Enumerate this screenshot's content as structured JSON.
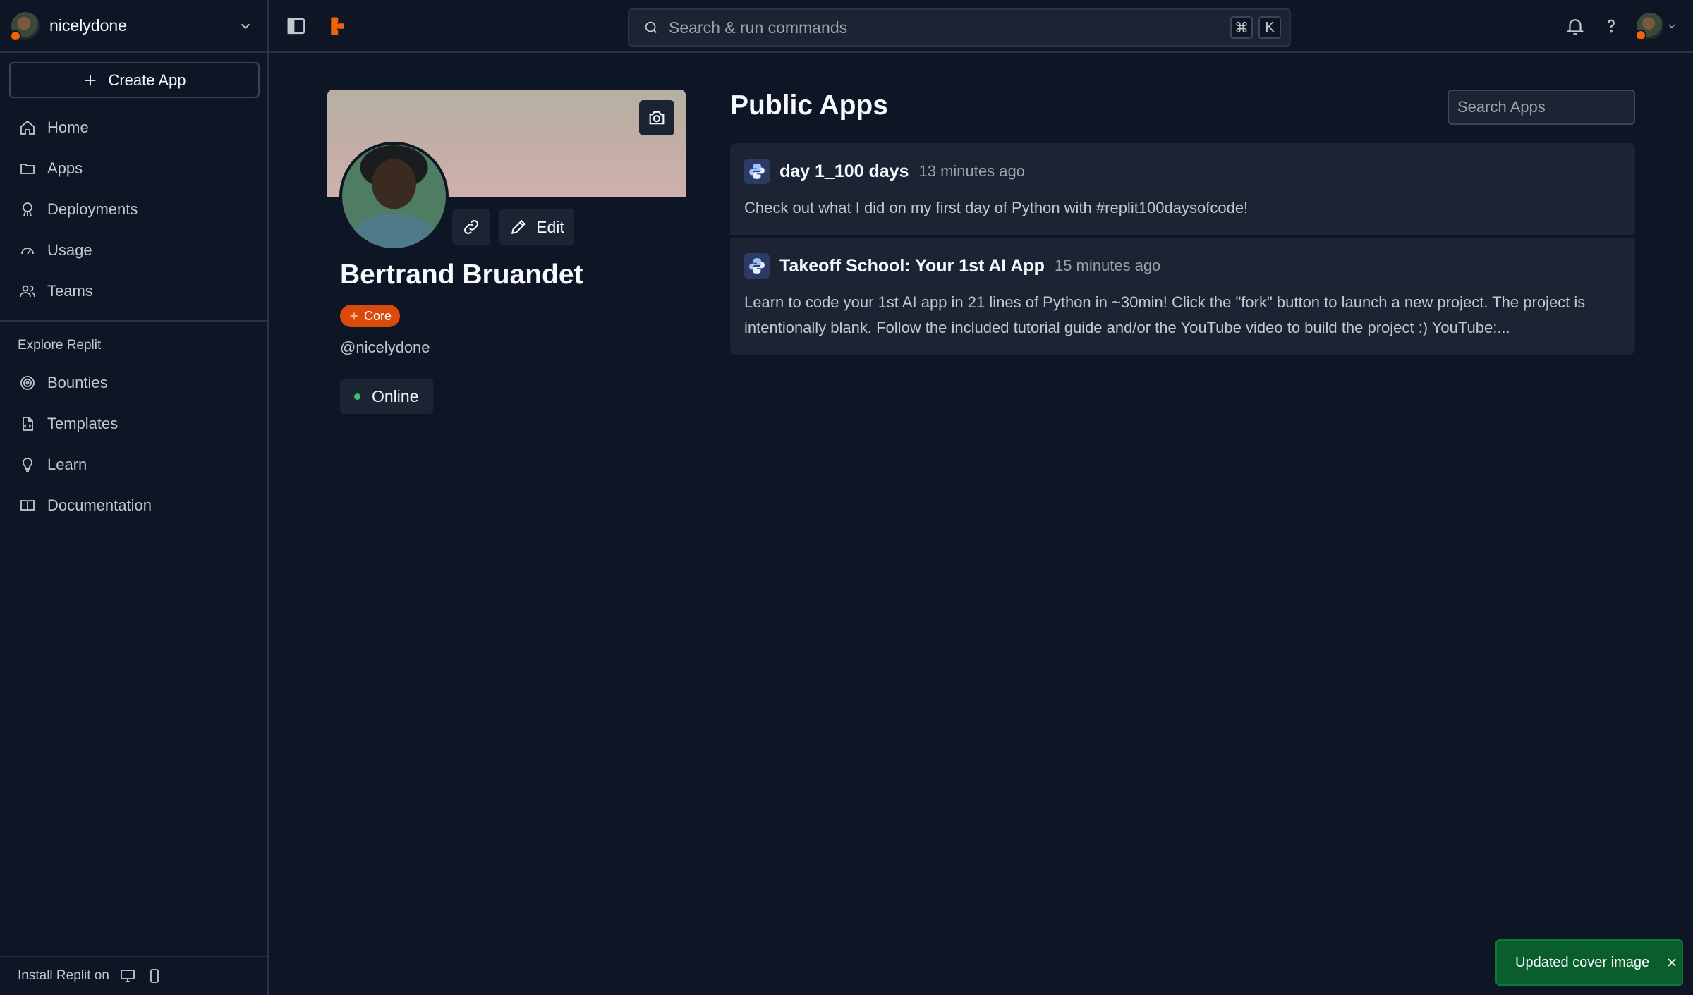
{
  "account": {
    "username": "nicelydone"
  },
  "sidebar": {
    "create_label": "Create App",
    "nav": [
      {
        "label": "Home",
        "icon": "home-icon"
      },
      {
        "label": "Apps",
        "icon": "folder-icon"
      },
      {
        "label": "Deployments",
        "icon": "deployments-icon"
      },
      {
        "label": "Usage",
        "icon": "gauge-icon"
      },
      {
        "label": "Teams",
        "icon": "teams-icon"
      }
    ],
    "explore_label": "Explore Replit",
    "explore": [
      {
        "label": "Bounties",
        "icon": "bounties-icon"
      },
      {
        "label": "Templates",
        "icon": "templates-icon"
      },
      {
        "label": "Learn",
        "icon": "lightbulb-icon"
      },
      {
        "label": "Documentation",
        "icon": "book-icon"
      }
    ],
    "install_label": "Install Replit on"
  },
  "topbar": {
    "search_placeholder": "Search & run commands",
    "shortcut_keys": [
      "⌘",
      "K"
    ]
  },
  "profile": {
    "name": "Bertrand Bruandet",
    "badge": "Core",
    "handle": "@nicelydone",
    "status": "Online",
    "edit_label": "Edit"
  },
  "public_apps": {
    "title": "Public Apps",
    "search_placeholder": "Search Apps",
    "apps": [
      {
        "name": "day 1_100 days",
        "time": "13 minutes ago",
        "description": "Check out what I did on my first day of Python with #replit100daysofcode!"
      },
      {
        "name": "Takeoff School: Your 1st AI App",
        "time": "15 minutes ago",
        "description": "Learn to code your 1st AI app in 21 lines of Python in ~30min! Click the \"fork\" button to launch a new project. The project is intentionally blank. Follow the included tutorial guide and/or the YouTube video to build the project :) YouTube:..."
      }
    ]
  },
  "toast": {
    "message": "Updated cover image"
  },
  "colors": {
    "background": "#0e1525",
    "surface": "#1c2333",
    "accent": "#f26207",
    "success": "#0a5d2c"
  }
}
